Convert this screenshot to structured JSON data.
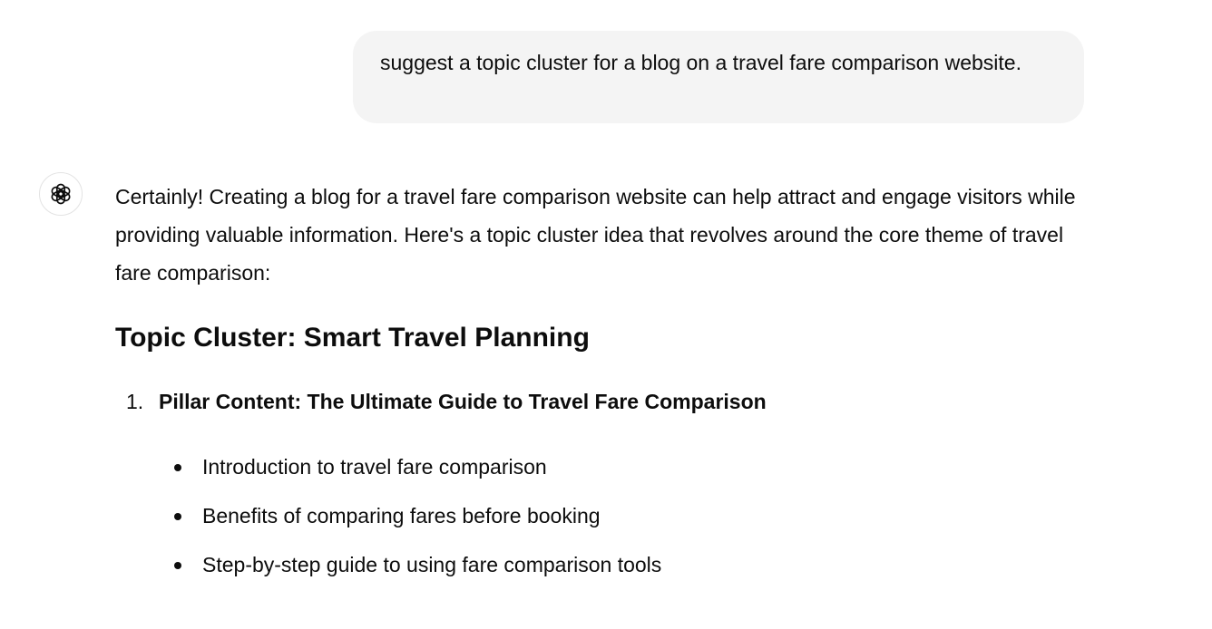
{
  "user_message": {
    "text": "suggest a topic cluster for a blog on a travel fare comparison website."
  },
  "assistant": {
    "avatar_icon": "openai-logo-icon",
    "intro": "Certainly! Creating a blog for a travel fare comparison website can help attract and engage visitors while providing valuable information. Here's a topic cluster idea that revolves around the core theme of travel fare comparison:",
    "heading": "Topic Cluster: Smart Travel Planning",
    "sections": [
      {
        "number": "1.",
        "title": "Pillar Content: The Ultimate Guide to Travel Fare Comparison",
        "bullets": [
          "Introduction to travel fare comparison",
          "Benefits of comparing fares before booking",
          "Step-by-step guide to using fare comparison tools"
        ]
      }
    ]
  }
}
